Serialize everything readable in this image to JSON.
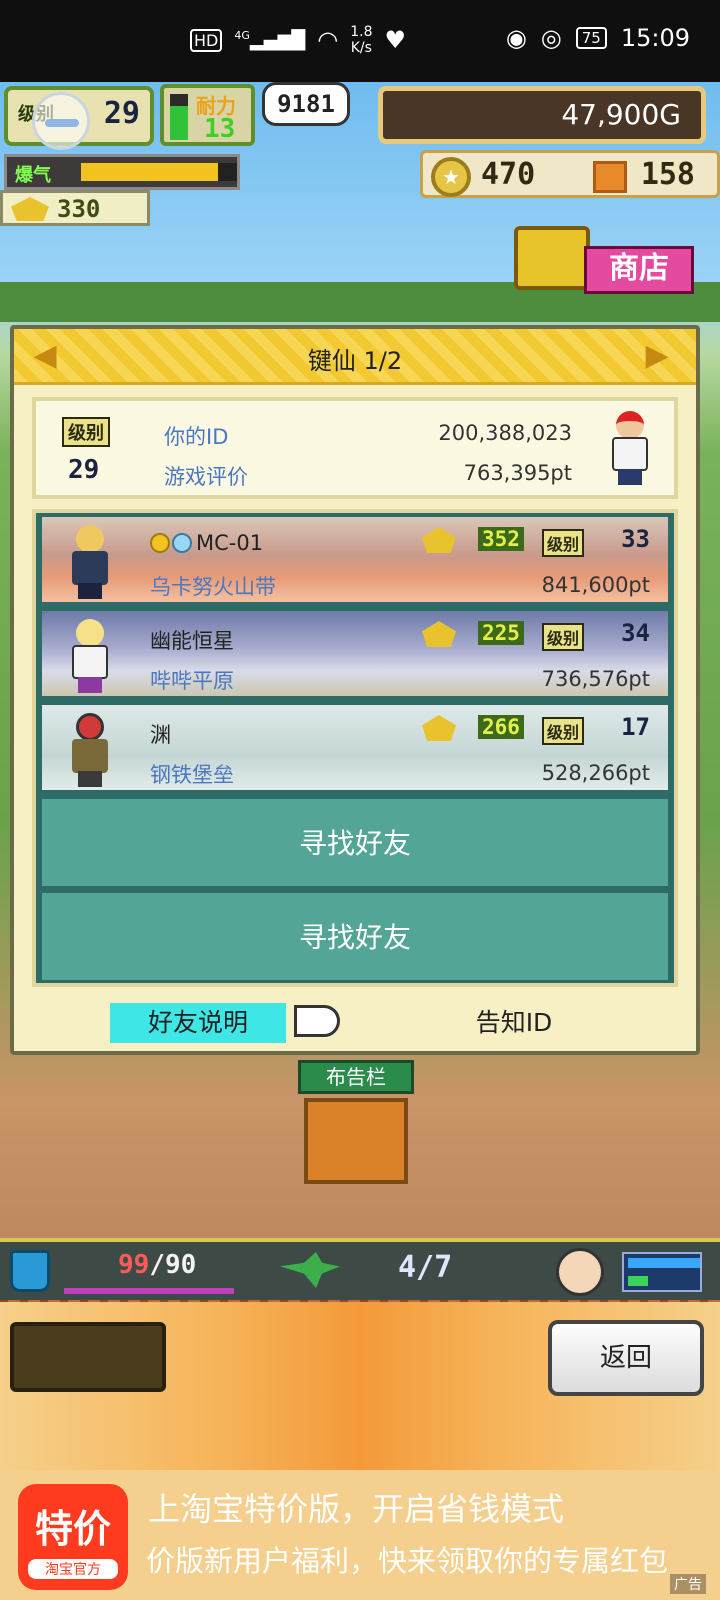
{
  "status_bar": {
    "hd": "HD",
    "signal": "4G",
    "net_speed_value": "1.8",
    "net_speed_unit": "K/s",
    "battery": "75",
    "time": "15:09"
  },
  "hud": {
    "level_label": "级别",
    "level": "29",
    "stamina_label": "耐力",
    "stamina": "13",
    "stamina_fill": 0.75,
    "bubble_text": "9181",
    "gold": "47,900G",
    "hype_label": "爆气",
    "hype_fill": 0.88,
    "fans": "330",
    "medals": "470",
    "cubes": "158",
    "shop_label": "商店"
  },
  "panel": {
    "title": "键仙 1/2",
    "me": {
      "level_label": "级别",
      "level": "29",
      "id_label": "你的ID",
      "id_value": "200,388,023",
      "rating_label": "游戏评价",
      "rating_value": "763,395pt"
    },
    "friends": [
      {
        "name": "MC-01",
        "area": "乌卡努火山带",
        "fans": "352",
        "level_label": "级别",
        "level": "33",
        "points": "841,600pt"
      },
      {
        "name": "幽能恒星",
        "area": "哔哔平原",
        "fans": "225",
        "level_label": "级别",
        "level": "34",
        "points": "736,576pt"
      },
      {
        "name": "渊",
        "area": "钢铁堡垒",
        "fans": "266",
        "level_label": "级别",
        "level": "17",
        "points": "528,266pt"
      }
    ],
    "find_friend_1": "寻找好友",
    "find_friend_2": "寻找好友",
    "help_label": "好友说明",
    "notify_label": "告知ID"
  },
  "scene": {
    "board_label": "布告栏"
  },
  "bottom_hud": {
    "hp_current": "99",
    "hp_max": "/90",
    "slots": "4/7"
  },
  "menu": {
    "back_label": "返回"
  },
  "ad": {
    "logo_big": "特价",
    "logo_small": "淘宝官方",
    "title": "上淘宝特价版，开启省钱模式",
    "subtitle": "价版新用户福利，快来领取你的专属红包",
    "tag": "广告"
  },
  "colors": {
    "panel_bg": "#f6f0c4",
    "find_button": "#53a696",
    "link_blue": "#4a78c2",
    "help_highlight": "#3ee6e6"
  }
}
